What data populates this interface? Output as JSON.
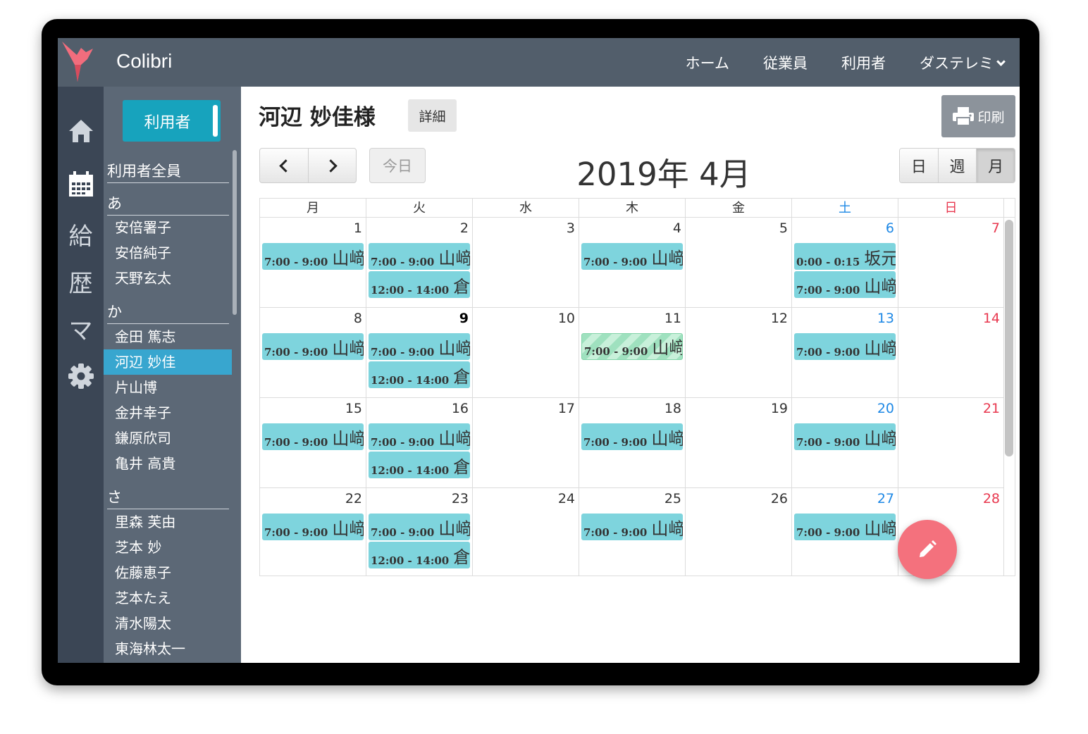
{
  "app": {
    "brand": "Colibri",
    "nav": [
      {
        "label": "ホーム"
      },
      {
        "label": "従業員"
      },
      {
        "label": "利用者"
      },
      {
        "label": "ダステレミ"
      }
    ],
    "colors": {
      "topbar": "#525e6b",
      "rail": "#3b4655",
      "sidebar": "#5c6876",
      "accent": "#17a3bd",
      "event": "#7ed4dd",
      "fab": "#f4717d"
    }
  },
  "rail": {
    "items": [
      {
        "icon": "home-icon"
      },
      {
        "icon": "calendar-icon"
      },
      {
        "label": "給"
      },
      {
        "label": "歴"
      },
      {
        "label": "マ"
      },
      {
        "icon": "gear-icon"
      }
    ]
  },
  "sidebar": {
    "button": "利用者",
    "all_label": "利用者全員",
    "groups": [
      {
        "label": "あ",
        "names": [
          "安倍署子",
          "安倍純子",
          "天野玄太"
        ]
      },
      {
        "label": "か",
        "names": [
          "金田 篤志",
          "河辺 妙佳",
          "片山博",
          "金井幸子",
          "鎌原欣司",
          "亀井 高貴"
        ]
      },
      {
        "label": "さ",
        "names": [
          "里森 芙由",
          "芝本 妙",
          "佐藤恵子",
          "芝本たえ",
          "清水陽太",
          "東海林太一"
        ]
      }
    ],
    "selected": "河辺 妙佳"
  },
  "main": {
    "title": "河辺 妙佳様",
    "detail_button": "詳細",
    "print_button": "印刷",
    "today_button": "今日",
    "month_title": "2019年 4月",
    "views": [
      "日",
      "週",
      "月"
    ],
    "active_view": "月"
  },
  "calendar": {
    "weekdays": [
      "月",
      "火",
      "水",
      "木",
      "金",
      "土",
      "日"
    ],
    "weeks": [
      [
        {
          "day": "1",
          "events": [
            {
              "time": "7:00 - 9:00",
              "name": "山﨑"
            }
          ]
        },
        {
          "day": "2",
          "events": [
            {
              "time": "7:00 - 9:00",
              "name": "山﨑"
            },
            {
              "time": "12:00 - 14:00",
              "name": "倉"
            }
          ]
        },
        {
          "day": "3",
          "events": []
        },
        {
          "day": "4",
          "events": [
            {
              "time": "7:00 - 9:00",
              "name": "山﨑"
            }
          ]
        },
        {
          "day": "5",
          "events": []
        },
        {
          "day": "6",
          "events": [
            {
              "time": "0:00 - 0:15",
              "name": "坂元"
            },
            {
              "time": "7:00 - 9:00",
              "name": "山﨑"
            }
          ]
        },
        {
          "day": "7",
          "events": []
        }
      ],
      [
        {
          "day": "8",
          "events": [
            {
              "time": "7:00 - 9:00",
              "name": "山﨑"
            }
          ]
        },
        {
          "day": "9",
          "events": [
            {
              "time": "7:00 - 9:00",
              "name": "山﨑"
            },
            {
              "time": "12:00 - 14:00",
              "name": "倉"
            }
          ],
          "today": true
        },
        {
          "day": "10",
          "events": []
        },
        {
          "day": "11",
          "events": [
            {
              "time": "7:00 - 9:00",
              "name": "山﨑",
              "striped": true
            }
          ]
        },
        {
          "day": "12",
          "events": []
        },
        {
          "day": "13",
          "events": [
            {
              "time": "7:00 - 9:00",
              "name": "山﨑"
            }
          ]
        },
        {
          "day": "14",
          "events": []
        }
      ],
      [
        {
          "day": "15",
          "events": [
            {
              "time": "7:00 - 9:00",
              "name": "山﨑"
            }
          ]
        },
        {
          "day": "16",
          "events": [
            {
              "time": "7:00 - 9:00",
              "name": "山﨑"
            },
            {
              "time": "12:00 - 14:00",
              "name": "倉"
            }
          ]
        },
        {
          "day": "17",
          "events": []
        },
        {
          "day": "18",
          "events": [
            {
              "time": "7:00 - 9:00",
              "name": "山﨑"
            }
          ]
        },
        {
          "day": "19",
          "events": []
        },
        {
          "day": "20",
          "events": [
            {
              "time": "7:00 - 9:00",
              "name": "山﨑"
            }
          ]
        },
        {
          "day": "21",
          "events": []
        }
      ],
      [
        {
          "day": "22",
          "events": [
            {
              "time": "7:00 - 9:00",
              "name": "山﨑"
            }
          ]
        },
        {
          "day": "23",
          "events": [
            {
              "time": "7:00 - 9:00",
              "name": "山﨑"
            },
            {
              "time": "12:00 - 14:00",
              "name": "倉"
            }
          ]
        },
        {
          "day": "24",
          "events": []
        },
        {
          "day": "25",
          "events": [
            {
              "time": "7:00 - 9:00",
              "name": "山﨑"
            }
          ]
        },
        {
          "day": "26",
          "events": []
        },
        {
          "day": "27",
          "events": [
            {
              "time": "7:00 - 9:00",
              "name": "山﨑"
            }
          ]
        },
        {
          "day": "28",
          "events": []
        }
      ]
    ]
  },
  "fab": {
    "icon": "pencil-icon"
  }
}
